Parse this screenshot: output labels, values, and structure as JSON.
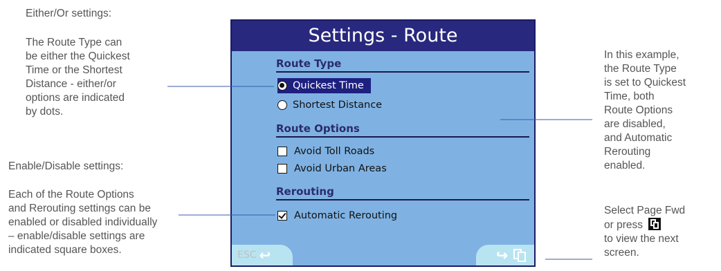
{
  "left_notes": {
    "either_or_heading": "Either/Or settings:",
    "either_or_lines": [
      "The Route Type can",
      "be either the Quickest",
      "Time or the Shortest",
      "Distance  - either/or",
      "options are indicated",
      "by dots."
    ],
    "enable_heading": "Enable/Disable settings:",
    "enable_lines": [
      "Each of the Route Options",
      "and Rerouting settings can be",
      "enabled or disabled individually",
      "– enable/disable settings are",
      "indicated square boxes."
    ]
  },
  "right_notes": {
    "example_lines": [
      "In this example,",
      "the Route Type",
      "is set to Quickest",
      "Time, both",
      "Route Options",
      "are disabled,",
      "and Automatic",
      "Rerouting",
      "enabled."
    ],
    "select_line1": "Select Page Fwd",
    "select_line2": "or press",
    "select_line3": "to view the next",
    "select_line4": "screen."
  },
  "device": {
    "title": "Settings - Route",
    "route_type_heading": "Route Type",
    "route_type_options": [
      {
        "label": "Quickest Time",
        "selected": true
      },
      {
        "label": "Shortest Distance",
        "selected": false
      }
    ],
    "route_options_heading": "Route Options",
    "route_options": [
      {
        "label": "Avoid Toll Roads",
        "checked": false
      },
      {
        "label": "Avoid Urban Areas",
        "checked": false
      }
    ],
    "rerouting_heading": "Rerouting",
    "rerouting_options": [
      {
        "label": "Automatic Rerouting",
        "checked": true
      }
    ],
    "esc_label": "ESC",
    "esc_icon": "return-arrow-icon",
    "fwd_icon": "page-forward-icon"
  },
  "colors": {
    "screen_bg": "#7fb2e3",
    "title_bg": "#28287e",
    "highlight": "#1e2080",
    "softkey_bg": "#b8e4f2"
  }
}
